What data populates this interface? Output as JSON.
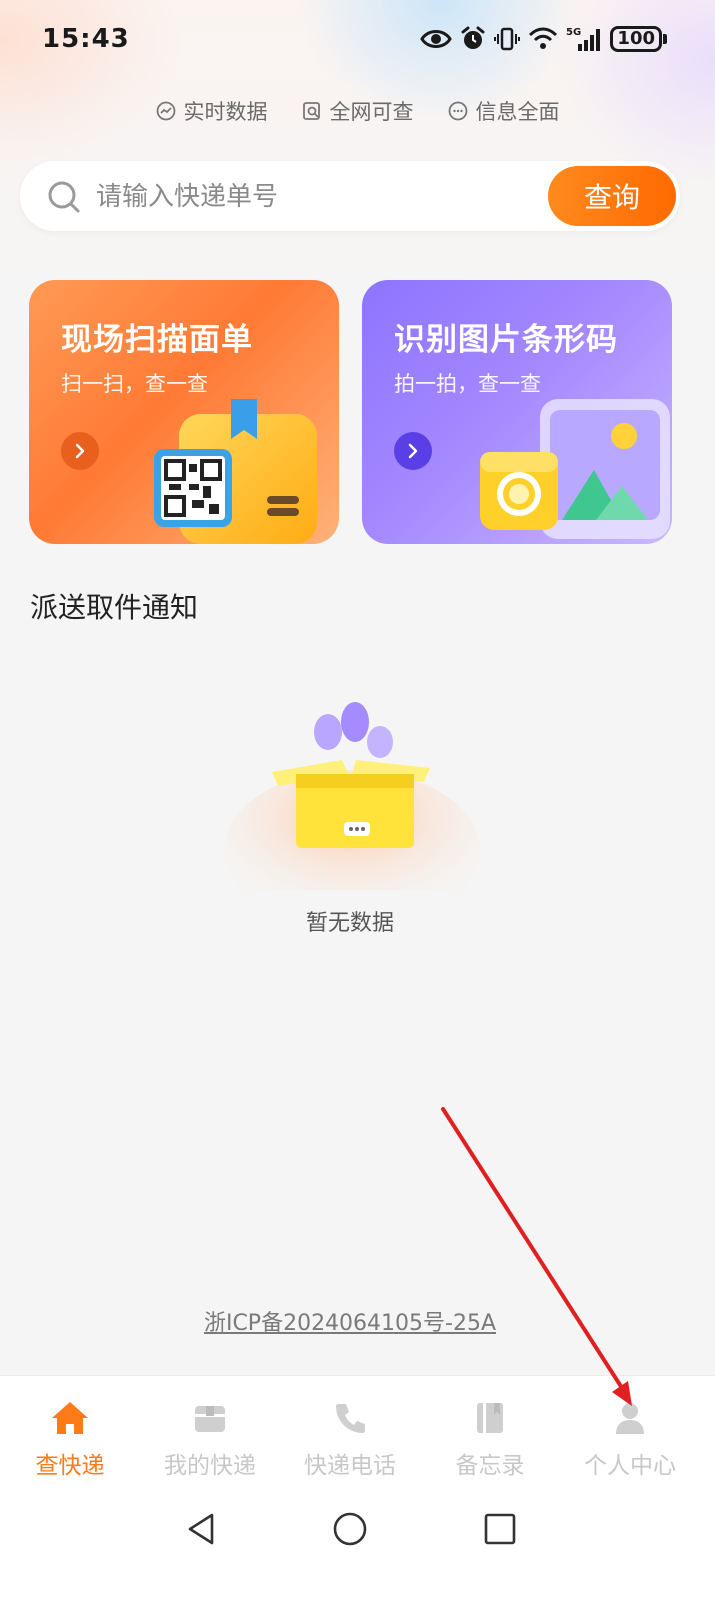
{
  "status_bar": {
    "time": "15:43",
    "battery": "100",
    "network": "5G",
    "icons": [
      "eye-icon",
      "alarm-icon",
      "vibrate-icon",
      "wifi-icon",
      "signal-icon",
      "battery-icon"
    ]
  },
  "features": [
    {
      "label": "实时数据",
      "icon": "chart-circle-icon"
    },
    {
      "label": "全网可查",
      "icon": "search-doc-icon"
    },
    {
      "label": "信息全面",
      "icon": "chat-dots-icon"
    }
  ],
  "search": {
    "placeholder": "请输入快递单号",
    "value": "",
    "button_label": "查询"
  },
  "cards": [
    {
      "title": "现场扫描面单",
      "subtitle": "扫一扫，查一查",
      "color": "#ff7a35"
    },
    {
      "title": "识别图片条形码",
      "subtitle": "拍一拍，查一查",
      "color": "#8d74ff"
    }
  ],
  "notifications": {
    "title": "派送取件通知",
    "empty_text": "暂无数据"
  },
  "footer": {
    "icp": "浙ICP备2024064105号-25A"
  },
  "tab_bar": {
    "active_color": "#ff7a18",
    "inactive_color": "#c8c8c8",
    "tabs": [
      {
        "label": "查快递",
        "icon": "home-icon",
        "active": true
      },
      {
        "label": "我的快递",
        "icon": "package-icon",
        "active": false
      },
      {
        "label": "快递电话",
        "icon": "phone-icon",
        "active": false
      },
      {
        "label": "备忘录",
        "icon": "notebook-icon",
        "active": false
      },
      {
        "label": "个人中心",
        "icon": "user-icon",
        "active": false
      }
    ]
  },
  "system_nav": [
    "back-icon",
    "home-circle-icon",
    "recents-icon"
  ],
  "annotation": {
    "color": "#e02020",
    "icon": "red-arrow-pointing-to-profile-tab"
  }
}
